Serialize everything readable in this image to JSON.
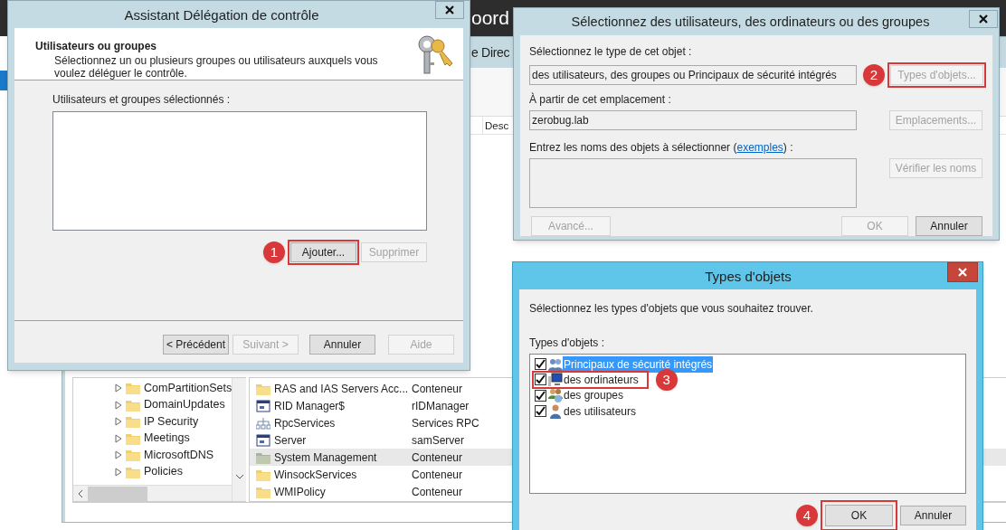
{
  "background": {
    "header_fragment": "oord",
    "window_title_fragment": "e Direc",
    "column_header_fragment": "Desc",
    "tree_items": [
      {
        "label": "ComPartitionSets"
      },
      {
        "label": "DomainUpdates"
      },
      {
        "label": "IP Security"
      },
      {
        "label": "Meetings"
      },
      {
        "label": "MicrosoftDNS"
      },
      {
        "label": "Policies"
      }
    ],
    "list_rows": [
      {
        "name": "RAS and IAS Servers Acc...",
        "type": "Conteneur",
        "kind": "folder",
        "selected": false
      },
      {
        "name": "RID Manager$",
        "type": "rIDManager",
        "kind": "object",
        "selected": false
      },
      {
        "name": "RpcServices",
        "type": "Services RPC",
        "kind": "service",
        "selected": false
      },
      {
        "name": "Server",
        "type": "samServer",
        "kind": "object",
        "selected": false
      },
      {
        "name": "System Management",
        "type": "Conteneur",
        "kind": "system-folder",
        "selected": true
      },
      {
        "name": "WinsockServices",
        "type": "Conteneur",
        "kind": "folder",
        "selected": false
      },
      {
        "name": "WMIPolicy",
        "type": "Conteneur",
        "kind": "folder",
        "selected": false
      }
    ]
  },
  "wizard": {
    "title": "Assistant Délégation de contrôle",
    "header_title": "Utilisateurs ou groupes",
    "header_description": "Sélectionnez un ou plusieurs groupes ou utilisateurs auxquels vous voulez déléguer le contrôle.",
    "list_label": "Utilisateurs et groupes sélectionnés :",
    "list_buttons": [
      {
        "label": "Ajouter...",
        "disabled": false,
        "callout": "1"
      },
      {
        "label": "Supprimer",
        "disabled": true
      }
    ],
    "nav_buttons": [
      {
        "label": "< Précédent",
        "disabled": false
      },
      {
        "label": "Suivant >",
        "disabled": true
      },
      {
        "label": "Annuler",
        "disabled": false
      },
      {
        "label": "Aide",
        "disabled": true
      }
    ]
  },
  "select_dialog": {
    "title": "Sélectionnez des utilisateurs, des ordinateurs ou des groupes",
    "object_type_label": "Sélectionnez le type de cet objet :",
    "object_type_value": "des utilisateurs, des groupes ou Principaux de sécurité intégrés",
    "object_type_button": {
      "label": "Types d'objets...",
      "disabled": true,
      "callout": "2"
    },
    "location_label": "À partir de cet emplacement :",
    "location_value": "zerobug.lab",
    "location_button": {
      "label": "Emplacements...",
      "disabled": true
    },
    "names_label": "Entrez les noms des objets à sélectionner (",
    "names_link": "exemples",
    "names_label_end": ") :",
    "check_button": {
      "label": "Vérifier les noms",
      "disabled": true
    },
    "advanced_button": {
      "label": "Avancé...",
      "disabled": true
    },
    "ok_button": {
      "label": "OK",
      "disabled": true
    },
    "cancel_button": {
      "label": "Annuler",
      "disabled": false
    }
  },
  "types_dialog": {
    "title": "Types d'objets",
    "instruction": "Sélectionnez les types d'objets que vous souhaitez trouver.",
    "list_label": "Types d'objets :",
    "items": [
      {
        "label": "Principaux de sécurité intégrés",
        "kind": "builtin",
        "checked": true,
        "selected": true
      },
      {
        "label": "des ordinateurs",
        "kind": "computer",
        "checked": true,
        "selected": false,
        "callout": "3"
      },
      {
        "label": "des groupes",
        "kind": "group",
        "checked": true,
        "selected": false
      },
      {
        "label": "des utilisateurs",
        "kind": "user",
        "checked": true,
        "selected": false
      }
    ],
    "ok_button": {
      "label": "OK",
      "disabled": false,
      "callout": "4"
    },
    "cancel_button": {
      "label": "Annuler",
      "disabled": false
    }
  }
}
